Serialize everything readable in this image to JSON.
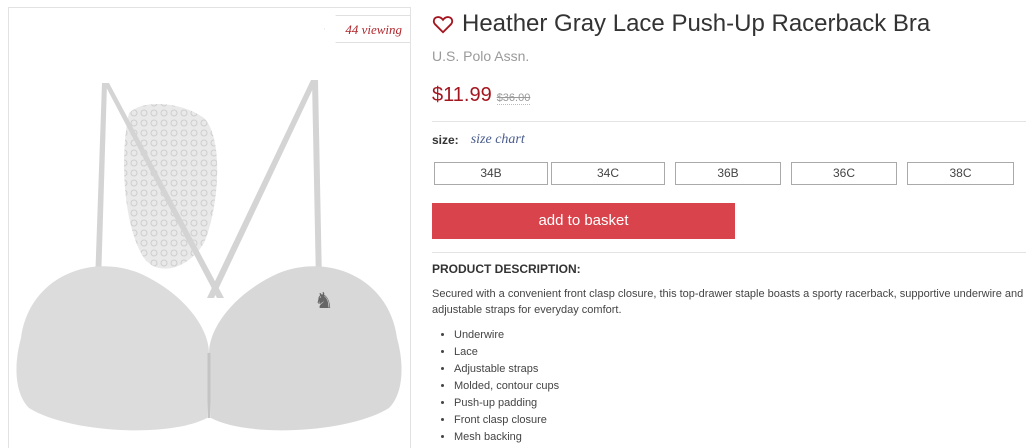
{
  "product": {
    "viewing": "44 viewing",
    "title": "Heather Gray Lace Push-Up Racerback Bra",
    "brand": "U.S. Polo Assn.",
    "price": "$11.99",
    "old_price": "$36.00"
  },
  "size": {
    "label": "size:",
    "chart_link": "size chart",
    "options": [
      "34B",
      "34C",
      "36B",
      "36C",
      "38C"
    ]
  },
  "actions": {
    "add_to_basket": "add to basket"
  },
  "description": {
    "heading": "PRODUCT DESCRIPTION:",
    "text": "Secured with a convenient front clasp closure, this top-drawer staple boasts a sporty racerback, supportive underwire and adjustable straps for everyday comfort.",
    "features": [
      "Underwire",
      "Lace",
      "Adjustable straps",
      "Molded, contour cups",
      "Push-up padding",
      "Front clasp closure",
      "Mesh backing"
    ]
  },
  "colors": {
    "accent_red": "#d9434b",
    "price_red": "#a4161f",
    "link_blue": "#4a5c8d"
  },
  "icons": {
    "favorite": "heart-outline-icon"
  }
}
